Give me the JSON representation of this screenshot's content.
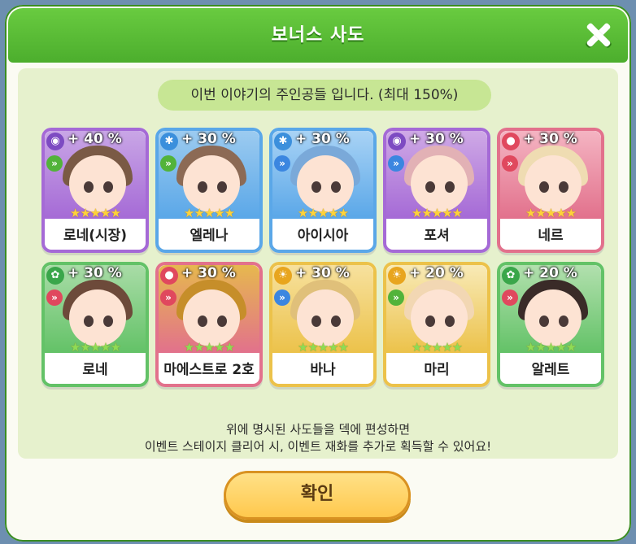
{
  "title": "보너스 사도",
  "subtitle": "이번 이야기의 주인공들 입니다. (최대 150%)",
  "notice_line1": "위에 명시된 사도들을 덱에 편성하면",
  "notice_line2": "이벤트 스테이지 클리어 시, 이벤트 재화를 추가로 획득할 수 있어요!",
  "confirm_label": "확인",
  "stars": "★★★★★",
  "characters": [
    {
      "name": "로네(시장)",
      "bonus": "+ 40 %",
      "element": "dark-icon",
      "class": "attacker-icon",
      "frame": "#a56ad6",
      "bg": "#c9a6e6",
      "hair": "#7a5a45",
      "star": "#ffd23a"
    },
    {
      "name": "엘레나",
      "bonus": "+ 30 %",
      "element": "water-icon",
      "class": "attacker-icon",
      "frame": "#5aa7e8",
      "bg": "#9ccbf0",
      "hair": "#8c6a55",
      "star": "#ffd23a"
    },
    {
      "name": "아이시아",
      "bonus": "+ 30 %",
      "element": "water-icon",
      "class": "supporter-icon",
      "frame": "#5aa7e8",
      "bg": "#a9d3f5",
      "hair": "#7aa9d9",
      "star": "#ffd23a"
    },
    {
      "name": "포셔",
      "bonus": "+ 30 %",
      "element": "dark-icon",
      "class": "supporter-icon",
      "frame": "#a56ad6",
      "bg": "#cfa9e6",
      "hair": "#e2b1b5",
      "star": "#ffd23a"
    },
    {
      "name": "네르",
      "bonus": "+ 30 %",
      "element": "fire-icon",
      "class": "tanker-icon",
      "frame": "#e2718c",
      "bg": "#f4b4c2",
      "hair": "#efdcb2",
      "star": "#ffd23a"
    },
    {
      "name": "로네",
      "bonus": "+ 30 %",
      "element": "forest-icon",
      "class": "tanker-icon",
      "frame": "#63c267",
      "bg": "#a9dca7",
      "hair": "#6d4a3a",
      "star": "#8fdc55"
    },
    {
      "name": "마에스트로 2호",
      "bonus": "+ 30 %",
      "element": "fire-icon",
      "class": "tanker-icon",
      "frame": "#e2718c",
      "bg": "#e6b84e",
      "hair": "#c68e2a",
      "star": "#8fdc55"
    },
    {
      "name": "바나",
      "bonus": "+ 30 %",
      "element": "light-icon",
      "class": "supporter-icon",
      "frame": "#ecc24a",
      "bg": "#f7e19e",
      "hair": "#e0c07a",
      "star": "#8fdc55"
    },
    {
      "name": "마리",
      "bonus": "+ 20 %",
      "element": "light-icon",
      "class": "attacker-icon",
      "frame": "#ecc24a",
      "bg": "#f8eab7",
      "hair": "#f2d7b3",
      "star": "#8fdc55"
    },
    {
      "name": "알레트",
      "bonus": "+ 20 %",
      "element": "forest-icon",
      "class": "tanker-icon",
      "frame": "#63c267",
      "bg": "#b2e0ae",
      "hair": "#3a2b28",
      "star": "#8fdc55"
    }
  ]
}
